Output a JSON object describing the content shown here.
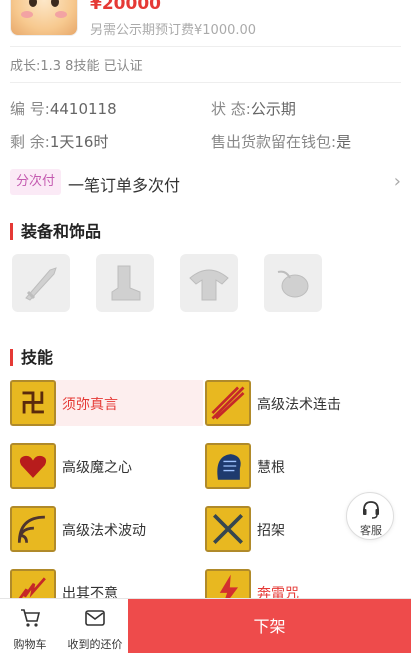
{
  "header": {
    "price": "¥20000",
    "deposit_note": "另需公示期预订费¥1000.00"
  },
  "growth_line": "成长:1.3 8技能 已认证",
  "info": {
    "id_label": "编  号:",
    "id_value": "4410118",
    "status_label": "状  态:",
    "status_value": "公示期",
    "remain_label": "剩  余:",
    "remain_value": "1天16时",
    "wallet_label": "售出货款留在钱包:",
    "wallet_value": "是"
  },
  "payment": {
    "badge": "分次付",
    "text": "一笔订单多次付",
    "arrow": "›"
  },
  "sections": {
    "equipment": "装备和饰品",
    "skills": "技能"
  },
  "equipment_icons": [
    "weapon-icon",
    "boots-icon",
    "armor-icon",
    "accessory-icon"
  ],
  "skills": [
    {
      "label": "须弥真言",
      "icon": "skill-xumi-icon",
      "state": "active"
    },
    {
      "label": "高级法术连击",
      "icon": "skill-combo-icon",
      "state": "normal"
    },
    {
      "label": "高级魔之心",
      "icon": "skill-heart-icon",
      "state": "normal"
    },
    {
      "label": "慧根",
      "icon": "skill-wisdom-icon",
      "state": "normal"
    },
    {
      "label": "高级法术波动",
      "icon": "skill-wave-icon",
      "state": "normal"
    },
    {
      "label": "招架",
      "icon": "skill-parry-icon",
      "state": "normal"
    },
    {
      "label": "出其不意",
      "icon": "skill-surprise-icon",
      "state": "normal"
    },
    {
      "label": "奔雷咒",
      "icon": "skill-thunder-icon",
      "state": "red"
    }
  ],
  "customer_service": {
    "label": "客服"
  },
  "bottom": {
    "cart": "购物车",
    "offers": "收到的还价",
    "action": "下架"
  },
  "colors": {
    "accent": "#e53935",
    "button": "#ee4b4b",
    "badge_bg": "#fbeaf6",
    "badge_text": "#c45ab0"
  }
}
